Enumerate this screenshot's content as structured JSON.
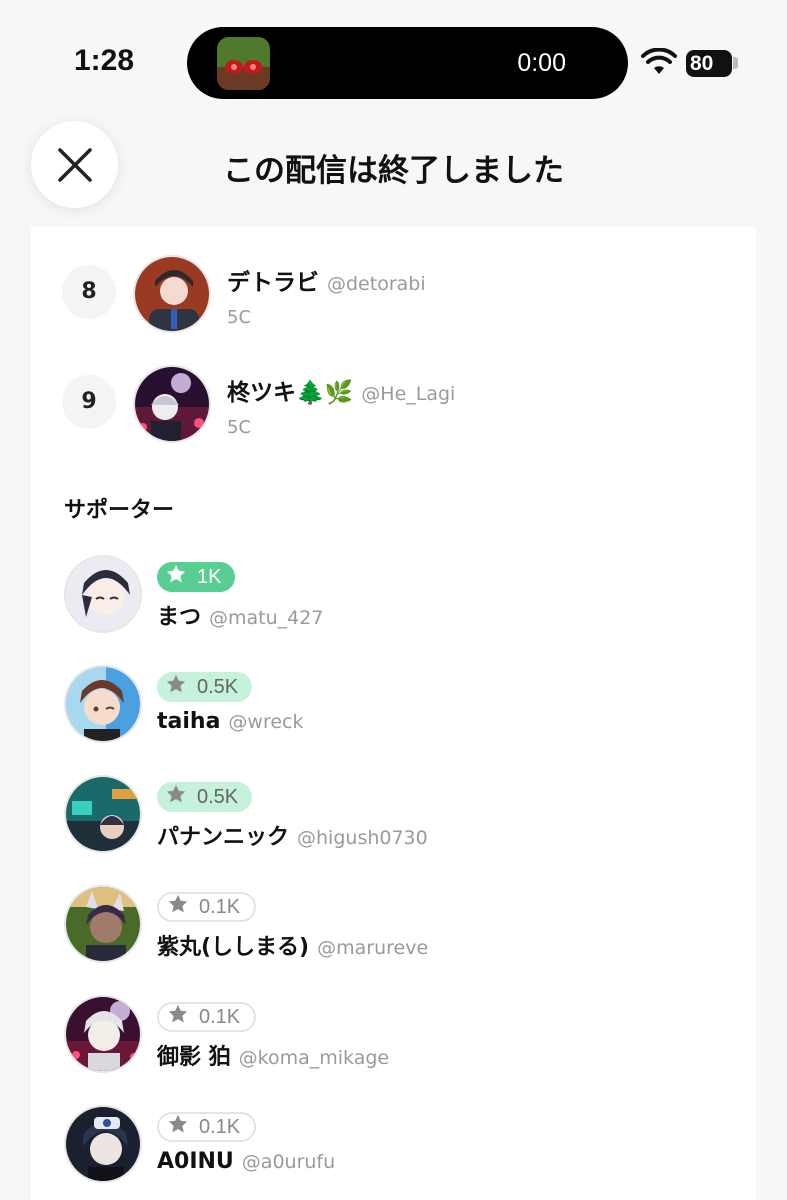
{
  "status_bar": {
    "time": "1:28",
    "live_activity_timer": "0:00",
    "battery_level": "80"
  },
  "header": {
    "title": "この配信は終了しました"
  },
  "ranking": [
    {
      "rank": "8",
      "name": "デトラビ",
      "handle": "@detorabi",
      "score": "5C",
      "avatar_colors": [
        "#9a3a22",
        "#3a2b25"
      ]
    },
    {
      "rank": "9",
      "name": "柊ツキ🌲🌿",
      "handle": "@He_Lagi",
      "score": "5C",
      "avatar_colors": [
        "#2a1030",
        "#c04070"
      ]
    }
  ],
  "supporters_section": {
    "title": "サポーター",
    "items": [
      {
        "badge": "1K",
        "name": "まつ",
        "handle": "@matu_427",
        "avatar_colors": [
          "#e8e6ee",
          "#2c2c3c"
        ]
      },
      {
        "badge": "0.5K",
        "name": "taiha",
        "handle": "@wreck",
        "avatar_colors": [
          "#4aa0e0",
          "#6a3a2a"
        ]
      },
      {
        "badge": "0.5K",
        "name": "パナンニック",
        "handle": "@higush0730",
        "avatar_colors": [
          "#1a6a6a",
          "#20303a"
        ]
      },
      {
        "badge": "0.1K",
        "name": "紫丸(ししまる)",
        "handle": "@marureve",
        "avatar_colors": [
          "#4a6a2a",
          "#3a2a4a"
        ]
      },
      {
        "badge": "0.1K",
        "name": "御影 狛",
        "handle": "@koma_mikage",
        "avatar_colors": [
          "#3a1030",
          "#e0e0e0"
        ]
      },
      {
        "badge": "0.1K",
        "name": "A0INU",
        "handle": "@a0urufu",
        "avatar_colors": [
          "#1a2030",
          "#4a6080"
        ]
      }
    ]
  },
  "colors": {
    "badge_gold": "#58cf92",
    "badge_silver": "#c6f1da",
    "badge_bronze_border": "#e4e4e4"
  }
}
